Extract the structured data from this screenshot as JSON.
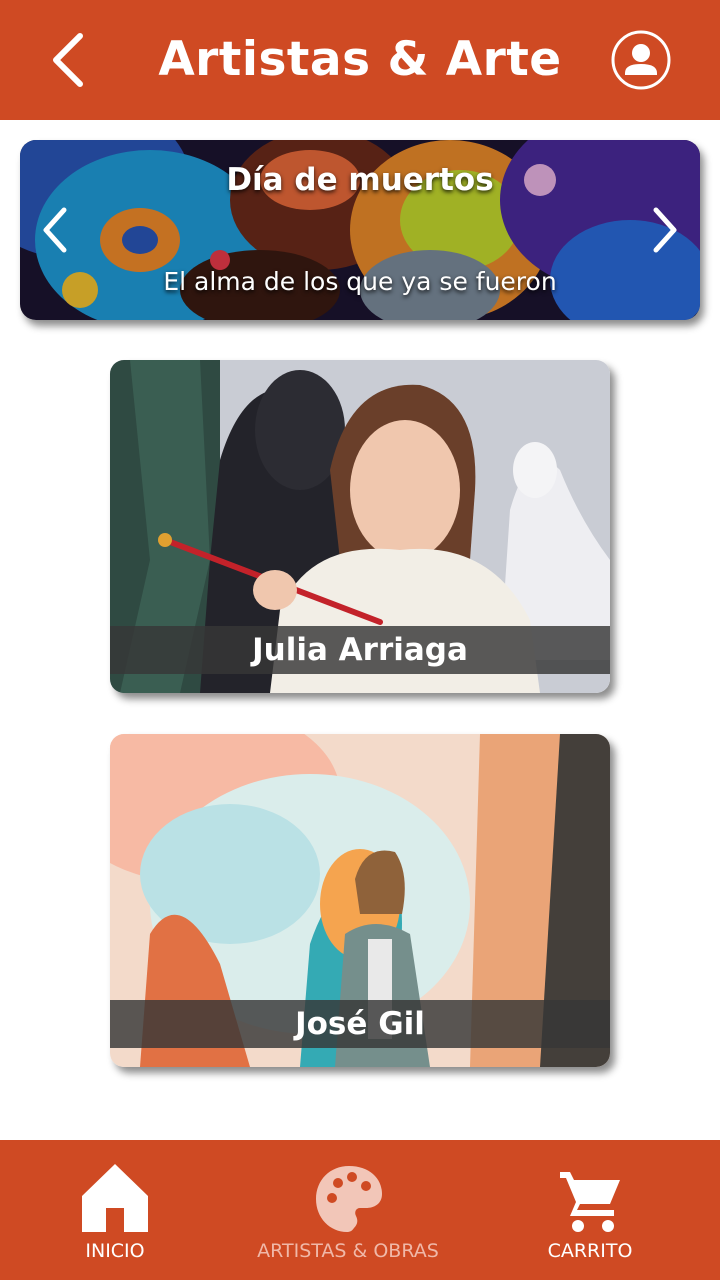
{
  "header": {
    "title": "Artistas & Arte",
    "back_icon": "chevron-left-icon",
    "user_icon": "user-circle-icon"
  },
  "banner": {
    "title": "Día de muertos",
    "subtitle": "El alma de los que ya se fueron"
  },
  "artists": [
    {
      "name": "Julia Arriaga"
    },
    {
      "name": "José Gil"
    }
  ],
  "bottom_nav": {
    "items": [
      {
        "label": "INICIO",
        "icon": "home-icon"
      },
      {
        "label": "ARTISTAS & OBRAS",
        "icon": "palette-icon"
      },
      {
        "label": "CARRITO",
        "icon": "cart-icon"
      }
    ]
  },
  "colors": {
    "brand": "#cf4a23",
    "nav_inactive_text": "#f0b8a8",
    "icon_dim": "#f2c6b8"
  }
}
